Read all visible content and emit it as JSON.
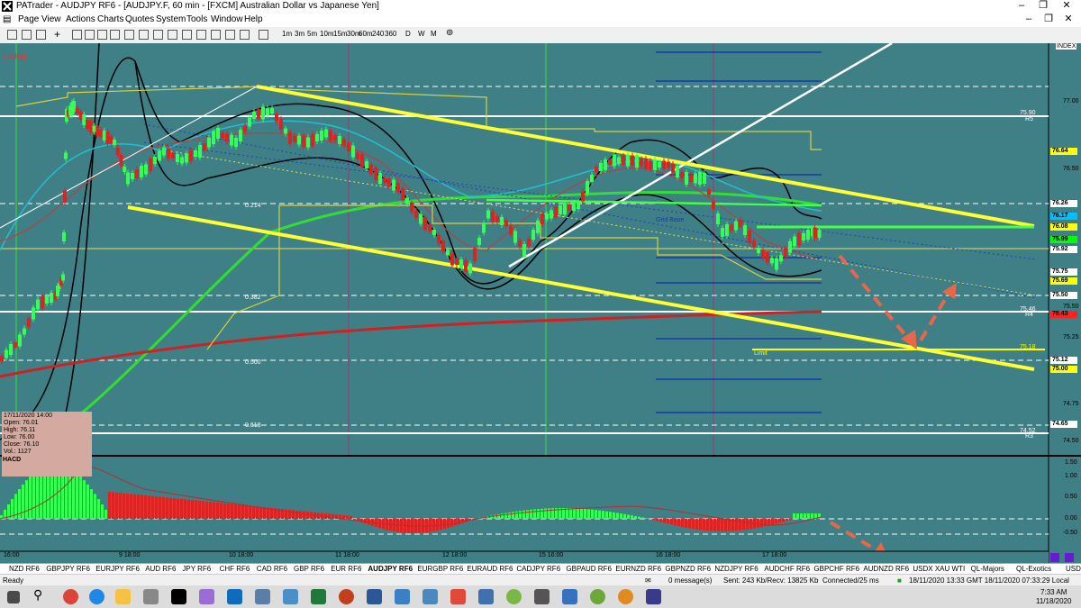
{
  "window": {
    "title": "PATrader - AUDJPY RF6 - [AUDJPY.F, 60 min - [FXCM] Australian Dollar vs Japanese Yen]"
  },
  "menu": [
    "Page",
    "View",
    "Actions",
    "Charts",
    "Quotes",
    "System",
    "Tools",
    "Window",
    "Help"
  ],
  "timeframes": [
    "1m",
    "3m",
    "5m",
    "10m",
    "15m",
    "30m",
    "60m",
    "240",
    "360",
    "D",
    "W",
    "M"
  ],
  "chart": {
    "locked_label": "Locked",
    "symbol_label": "INDEX",
    "ohlc_box": [
      "17/11/2020 14:00",
      "Open: 76.01",
      "High: 76.11",
      "Low: 76.00",
      "Close: 76.10",
      "Vol.: 1127"
    ],
    "price_axis": [
      "77.00",
      "76.50",
      "75.50",
      "75.25",
      "74.75",
      "74.50"
    ],
    "price_tags": [
      {
        "text": "76.64",
        "color": "#ffff00"
      },
      {
        "text": "76.26",
        "color": "#ffffff"
      },
      {
        "text": "76.17",
        "color": "#00bfff"
      },
      {
        "text": "76.08",
        "color": "#ffff00"
      },
      {
        "text": "75.99",
        "color": "#00ff00"
      },
      {
        "text": "75.92",
        "color": "#ffffff"
      },
      {
        "text": "75.75",
        "color": "#ffffff"
      },
      {
        "text": "75.69",
        "color": "#ffff00"
      },
      {
        "text": "75.50",
        "color": "#ffffff"
      },
      {
        "text": "75.43",
        "color": "#ff2020"
      },
      {
        "text": "75.12",
        "color": "#ffffff"
      },
      {
        "text": "75.00",
        "color": "#ffff00"
      },
      {
        "text": "74.65",
        "color": "#ffffff"
      }
    ],
    "levels": [
      "R5",
      "R4",
      "R3"
    ],
    "level_values": [
      "75.90",
      "75.46",
      "74.52",
      "75.18"
    ],
    "fib": [
      "0.214",
      "0.382",
      "0.500",
      "0.618"
    ],
    "zone_labels": [
      "Grid Base",
      "Limit"
    ],
    "time_axis": [
      "16:00",
      "9 18:00",
      "10 18:00",
      "11 18:00",
      "12 18:00",
      "15 16:00",
      "16 18:00",
      "17 18:00"
    ],
    "indicator": {
      "name": "HACD",
      "axis": [
        "1.50",
        "1.00",
        "0.50",
        "0.00",
        "-0.50"
      ]
    }
  },
  "symbol_tabs": [
    "NZD RF6",
    "GBPJPY RF6",
    "EURJPY RF6",
    "AUD RF6",
    "JPY RF6",
    "CHF RF6",
    "CAD RF6",
    "GBP RF6",
    "EUR RF6",
    "AUDJPY RF6",
    "EURGBP RF6",
    "EURAUD RF6",
    "CADJPY RF6",
    "GBPAUD RF6",
    "EURNZD RF6",
    "GBPNZD RF6",
    "NZDJPY RF6",
    "AUDCHF RF6",
    "GBPCHF RF6",
    "AUDNZD RF6",
    "USDX XAU WTI",
    "QL-Majors",
    "QL-Exotics",
    "USDX RF6"
  ],
  "active_tab": "AUDJPY RF6",
  "status": {
    "ready": "Ready",
    "messages": "0 message(s)",
    "traffic": "Sent: 243 Kb/Recv: 13825 Kb",
    "connection": "Connected/25 ms",
    "time": "18/11/2020 13:33 GMT  18/11/2020 07:33:29 Local"
  },
  "taskbar": {
    "time": "7:33 AM",
    "date": "11/18/2020"
  },
  "colors": {
    "chart_bg": "#3f7f86",
    "channel": "#ffff33",
    "arrow": "#e8674a",
    "bull": "#33ff55",
    "bear": "#dd2222"
  }
}
